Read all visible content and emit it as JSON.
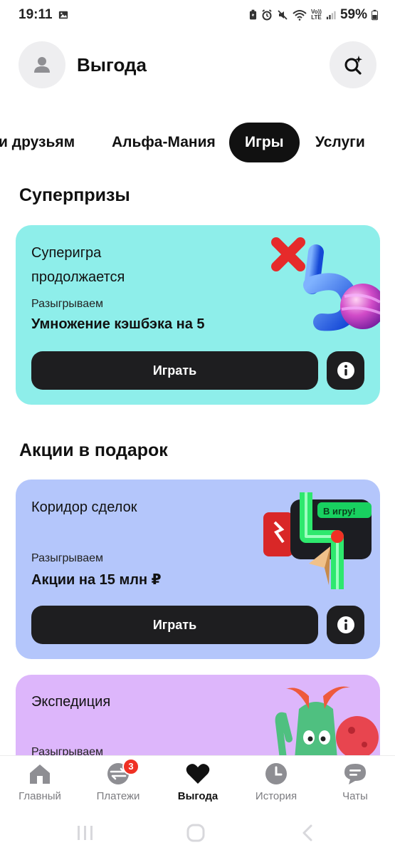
{
  "status_bar": {
    "time": "19:11",
    "battery": "59%",
    "icons": [
      "gallery-icon",
      "battery-saver-icon",
      "alarm-icon",
      "mute-icon",
      "wifi-icon",
      "volte-icon",
      "signal-icon",
      "battery-icon"
    ],
    "volte_line1": "Vo))",
    "volte_line2": "LTE"
  },
  "header": {
    "title": "Выгода",
    "avatar_icon": "person-icon",
    "search_icon": "sparkle-search-icon"
  },
  "tabs": [
    {
      "label": "и друзьям",
      "active": false
    },
    {
      "label": "Альфа-Мания",
      "active": false
    },
    {
      "label": "Игры",
      "active": true
    },
    {
      "label": "Услуги",
      "active": false
    }
  ],
  "sections": {
    "superprizes": "Суперпризы",
    "gift_shares": "Акции в подарок"
  },
  "cards": [
    {
      "title_line1": "Суперигра",
      "title_line2": "продолжается",
      "subtitle": "Разыгрываем",
      "prize": "Умножение кэшбэка на 5",
      "button": "Играть",
      "info_icon": "info-icon",
      "bg": "#8eeeea"
    },
    {
      "title_line1": "Коридор сделок",
      "subtitle": "Разыгрываем",
      "prize": "Акции на 15 млн ₽",
      "button": "Играть",
      "info_icon": "info-icon",
      "art_text": "В игру!",
      "bg": "#b4c6fb"
    },
    {
      "title_line1": "Экспедиция",
      "subtitle": "Разыгрываем",
      "bg": "#ddb6fb"
    }
  ],
  "bottom_nav": [
    {
      "label": "Главный",
      "icon": "home-icon",
      "active": false
    },
    {
      "label": "Платежи",
      "icon": "payments-icon",
      "badge": "3",
      "active": false
    },
    {
      "label": "Выгода",
      "icon": "heart-icon",
      "active": true
    },
    {
      "label": "История",
      "icon": "clock-icon",
      "active": false
    },
    {
      "label": "Чаты",
      "icon": "chat-icon",
      "active": false
    }
  ],
  "colors": {
    "accent_dark": "#1e1e20",
    "badge_red": "#ef3124",
    "inactive_nav": "#8e8e93"
  }
}
